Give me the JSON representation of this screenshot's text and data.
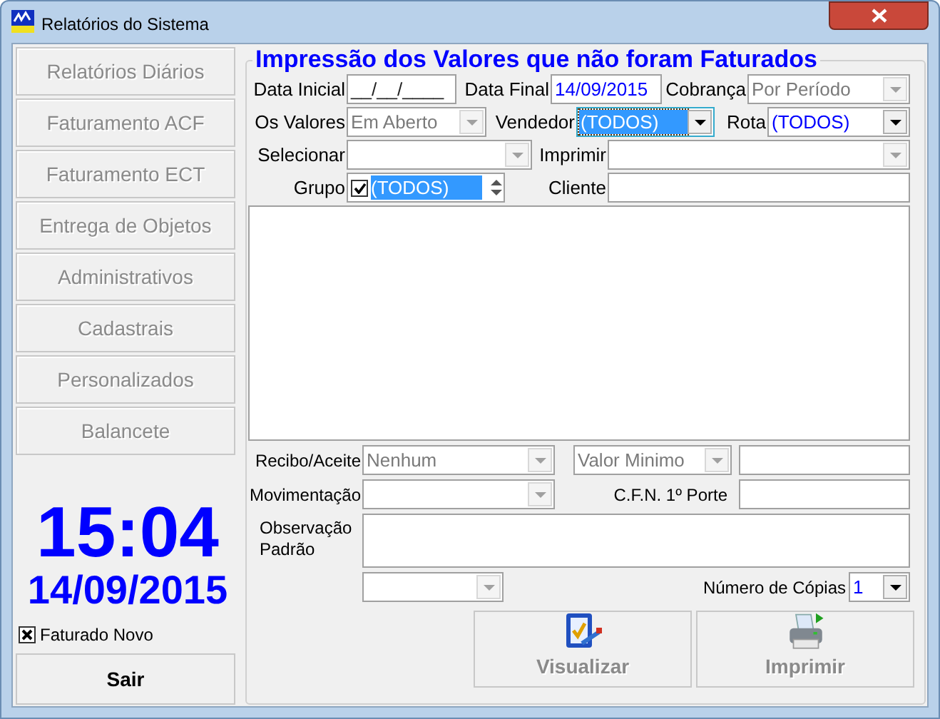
{
  "window": {
    "title": "Relatórios do Sistema"
  },
  "sidebar": {
    "buttons": [
      {
        "label": "Relatórios Diários",
        "disabled": true
      },
      {
        "label": "Faturamento ACF",
        "disabled": true
      },
      {
        "label": "Faturamento ECT",
        "disabled": true
      },
      {
        "label": "Entrega de Objetos",
        "disabled": true
      },
      {
        "label": "Administrativos",
        "disabled": true
      },
      {
        "label": "Cadastrais",
        "disabled": true
      },
      {
        "label": "Personalizados",
        "disabled": true
      },
      {
        "label": "Balancete",
        "disabled": true
      }
    ],
    "clock": {
      "time": "15:04",
      "date": "14/09/2015"
    },
    "faturado_novo": {
      "label": "Faturado Novo",
      "checked": true
    },
    "exit_button": {
      "label": "Sair",
      "disabled": false
    }
  },
  "form": {
    "title": "Impressão dos Valores que não foram Faturados",
    "data_inicial": {
      "label": "Data Inicial",
      "placeholder": "__/__/____"
    },
    "data_final": {
      "label": "Data Final",
      "value": "14/09/2015"
    },
    "cobranca": {
      "label": "Cobrança",
      "value": "Por Período",
      "disabled": true,
      "selected": false
    },
    "os_valores": {
      "label": "Os Valores",
      "value": "Em Aberto",
      "disabled": true,
      "selected": false
    },
    "vendedor": {
      "label": "Vendedor",
      "value": "(TODOS)",
      "disabled": false,
      "selected": true
    },
    "rota": {
      "label": "Rota",
      "value": "(TODOS)",
      "disabled": false,
      "selected": false
    },
    "selecionar": {
      "label": "Selecionar",
      "disabled": true,
      "selected": false
    },
    "imprimir": {
      "label": "Imprimir",
      "disabled": true,
      "selected": false
    },
    "grupo": {
      "label": "Grupo",
      "checked": true,
      "value": "(TODOS)",
      "selected": true
    },
    "cliente": {
      "label": "Cliente"
    },
    "recibo_aceite": {
      "label": "Recibo/Aceite",
      "value": "Nenhum",
      "disabled": true,
      "selected": false
    },
    "valor_minimo": {
      "value": "Valor Minimo",
      "disabled": true,
      "selected": false
    },
    "movimentacao": {
      "label": "Movimentação",
      "disabled": true,
      "selected": false
    },
    "cfn_1_porte": {
      "label": "C.F.N. 1º Porte"
    },
    "observacao_padrao": {
      "label": "Observação Padrão"
    },
    "combo_4": {
      "disabled": true,
      "selected": false
    },
    "numero_copias": {
      "label": "Número de Cópias",
      "value": "1",
      "disabled": false,
      "selected": false
    },
    "buttons": [
      {
        "label": "Visualizar",
        "kind": "preview",
        "disabled": true
      },
      {
        "label": "Imprimir",
        "kind": "print",
        "disabled": true
      }
    ]
  }
}
